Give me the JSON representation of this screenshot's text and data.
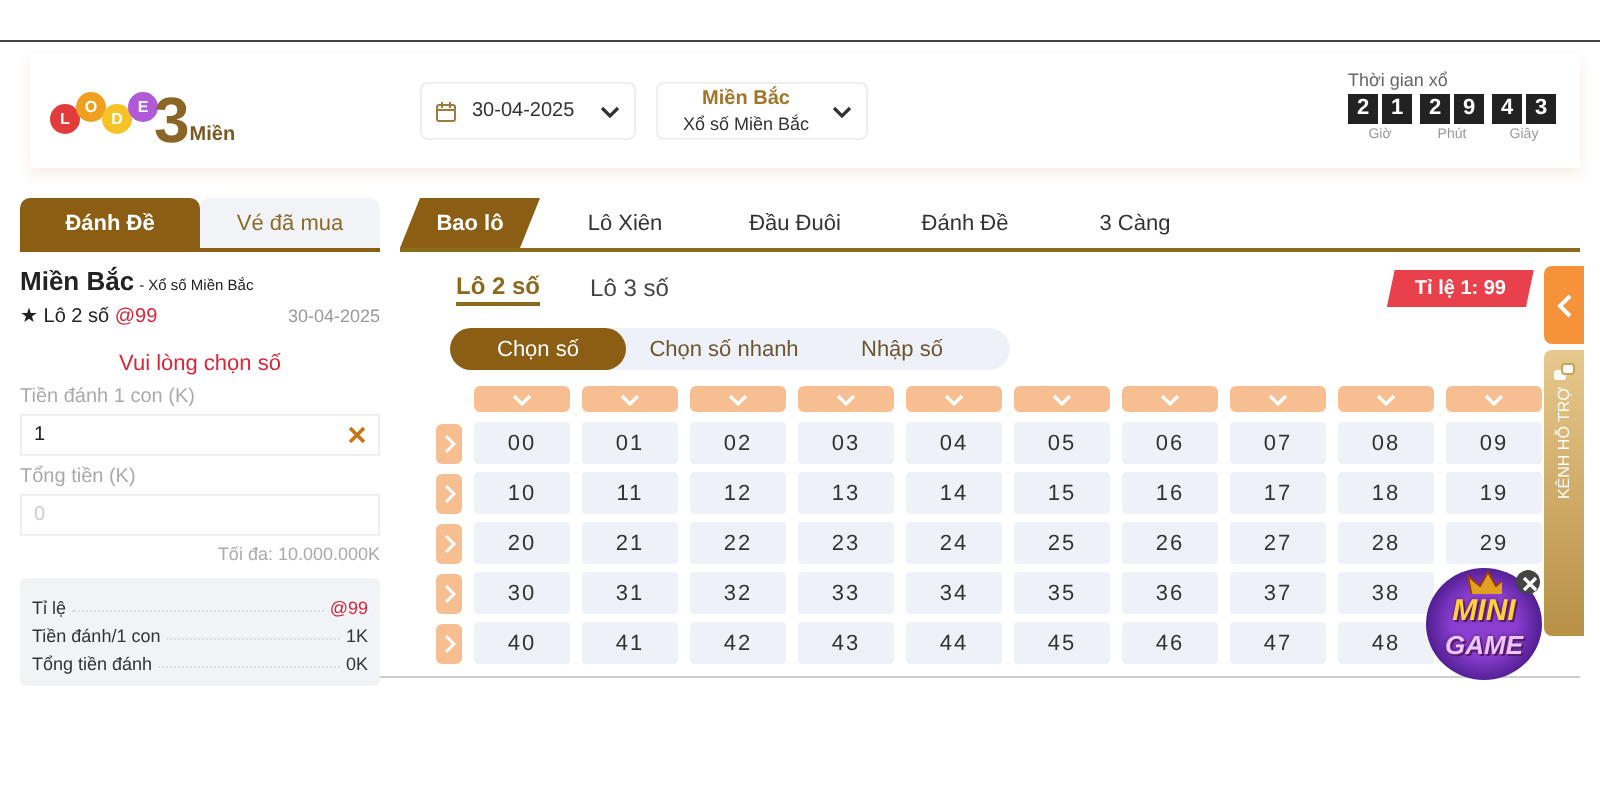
{
  "logo": {
    "balls": [
      {
        "letter": "L",
        "color": "#e23b3b"
      },
      {
        "letter": "O",
        "color": "#f0a020"
      },
      {
        "letter": "D",
        "color": "#f5c325"
      },
      {
        "letter": "E",
        "color": "#b05ad8"
      }
    ],
    "digit": "3",
    "word": "Miền"
  },
  "date_select": {
    "value": "30-04-2025"
  },
  "region_select": {
    "title": "Miền Bắc",
    "subtitle": "Xổ số Miền Bắc"
  },
  "countdown": {
    "label": "Thời gian xổ",
    "groups": [
      {
        "digits": [
          "2",
          "1"
        ],
        "unit": "Giờ"
      },
      {
        "digits": [
          "2",
          "9"
        ],
        "unit": "Phút"
      },
      {
        "digits": [
          "4",
          "3"
        ],
        "unit": "Giây"
      }
    ]
  },
  "bet_panel": {
    "tabs": [
      {
        "label": "Đánh Đề",
        "selected": true
      },
      {
        "label": "Vé đã mua",
        "selected": false
      }
    ],
    "region": "Miền Bắc",
    "lottery": "- Xổ số Miền Bắc",
    "bet_type": "★ Lô 2 số",
    "odds": "@99",
    "date": "30-04-2025",
    "warning": "Vui lòng chọn số",
    "fields": [
      {
        "label": "Tiền đánh 1 con (K)",
        "value": "1",
        "clearable": true
      },
      {
        "label": "Tổng tiền (K)",
        "placeholder": "0",
        "clearable": false
      }
    ],
    "limit": "Tối đa: 10.000.000K",
    "summary": [
      {
        "label": "Tỉ lệ",
        "value": "@99",
        "highlight": true
      },
      {
        "label": "Tiền đánh/1 con",
        "value": "1K",
        "highlight": false
      },
      {
        "label": "Tổng tiền đánh",
        "value": "0K",
        "highlight": false
      }
    ]
  },
  "game_tabs": [
    {
      "label": "Bao lô",
      "selected": true
    },
    {
      "label": "Lô Xiên",
      "selected": false
    },
    {
      "label": "Đầu Đuôi",
      "selected": false
    },
    {
      "label": "Đánh Đề",
      "selected": false
    },
    {
      "label": "3 Càng",
      "selected": false
    }
  ],
  "sub_tabs": [
    {
      "label": "Lô 2 số",
      "selected": true
    },
    {
      "label": "Lô 3 số",
      "selected": false
    }
  ],
  "rate_badge": "Tỉ lệ 1: 99",
  "modes": [
    {
      "label": "Chọn số",
      "selected": true
    },
    {
      "label": "Chọn số nhanh",
      "selected": false
    },
    {
      "label": "Nhập số",
      "selected": false
    }
  ],
  "number_grid": {
    "rows": [
      [
        "00",
        "01",
        "02",
        "03",
        "04",
        "05",
        "06",
        "07",
        "08",
        "09"
      ],
      [
        "10",
        "11",
        "12",
        "13",
        "14",
        "15",
        "16",
        "17",
        "18",
        "19"
      ],
      [
        "20",
        "21",
        "22",
        "23",
        "24",
        "25",
        "26",
        "27",
        "28",
        "29"
      ],
      [
        "30",
        "31",
        "32",
        "33",
        "34",
        "35",
        "36",
        "37",
        "38"
      ],
      [
        "40",
        "41",
        "42",
        "43",
        "44",
        "45",
        "46",
        "47",
        "48"
      ]
    ]
  },
  "support_tab": {
    "label": "KÊNH HỖ TRỢ"
  },
  "minigame": {
    "line1": "MINI",
    "line2": "GAME"
  }
}
